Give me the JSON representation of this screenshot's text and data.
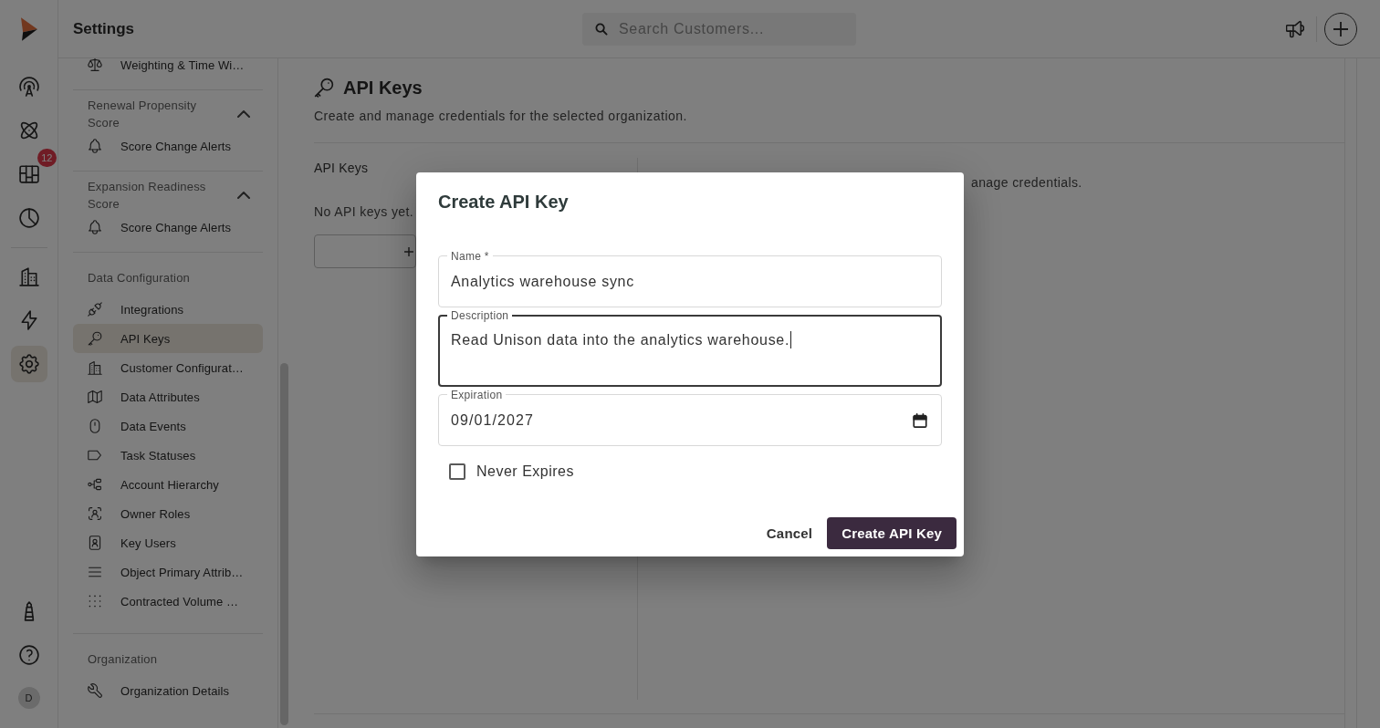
{
  "rail": {
    "main_items": [
      {
        "selected": false
      },
      {
        "selected": false
      },
      {
        "selected": false,
        "badge": "12"
      },
      {
        "selected": false
      }
    ],
    "more_items": [
      {
        "selected": false
      },
      {
        "selected": false
      },
      {
        "selected": true
      }
    ],
    "footer_items": [
      {
        "selected": false
      },
      {
        "selected": false
      }
    ],
    "avatar": "D"
  },
  "header": {
    "title": "Settings",
    "search": {
      "placeholder": "Search Customers..."
    }
  },
  "settings_nav": {
    "sections": [
      {
        "items": [
          {
            "label": "Weighting & Time Wi…",
            "selected": false
          }
        ]
      },
      {
        "title": "Renewal Propensity Score",
        "expanded": true,
        "items": [
          {
            "label": "Score Change Alerts",
            "selected": false
          }
        ]
      },
      {
        "title": "Expansion Readiness Score",
        "expanded": true,
        "items": [
          {
            "label": "Score Change Alerts",
            "selected": false
          }
        ]
      },
      {
        "title": "Data Configuration",
        "items": [
          {
            "label": "Integrations",
            "selected": false
          },
          {
            "label": "API Keys",
            "selected": true
          },
          {
            "label": "Customer Configurat…",
            "selected": false
          },
          {
            "label": "Data Attributes",
            "selected": false
          },
          {
            "label": "Data Events",
            "selected": false
          },
          {
            "label": "Task Statuses",
            "selected": false
          },
          {
            "label": "Account Hierarchy",
            "selected": false
          },
          {
            "label": "Owner Roles",
            "selected": false
          },
          {
            "label": "Key Users",
            "selected": false
          },
          {
            "label": "Object Primary Attrib…",
            "selected": false
          },
          {
            "label": "Contracted Volume …",
            "selected": false
          }
        ]
      },
      {
        "title": "Organization",
        "items": [
          {
            "label": "Organization Details",
            "selected": false
          }
        ]
      }
    ]
  },
  "page": {
    "title": "API Keys",
    "subtitle": "Create and manage credentials for the selected organization.",
    "list_pane": {
      "heading": "API Keys",
      "empty_text": "No API keys yet."
    },
    "detail_pane": {
      "text": "anage credentials."
    }
  },
  "dialog": {
    "title": "Create API Key",
    "fields": [
      {
        "kind": "text",
        "label": "Name *",
        "value": "Analytics warehouse sync",
        "focused": false
      },
      {
        "kind": "textarea",
        "label": "Description",
        "value": "Read Unison data into the analytics warehouse.",
        "focused": true
      },
      {
        "kind": "date",
        "label": "Expiration",
        "value": "09/01/2027",
        "focused": false
      }
    ],
    "never_expires": {
      "label": "Never Expires",
      "checked": false
    },
    "buttons": [
      {
        "kind": "text",
        "label": "Cancel"
      },
      {
        "kind": "contained",
        "label": "Create API Key"
      }
    ]
  }
}
